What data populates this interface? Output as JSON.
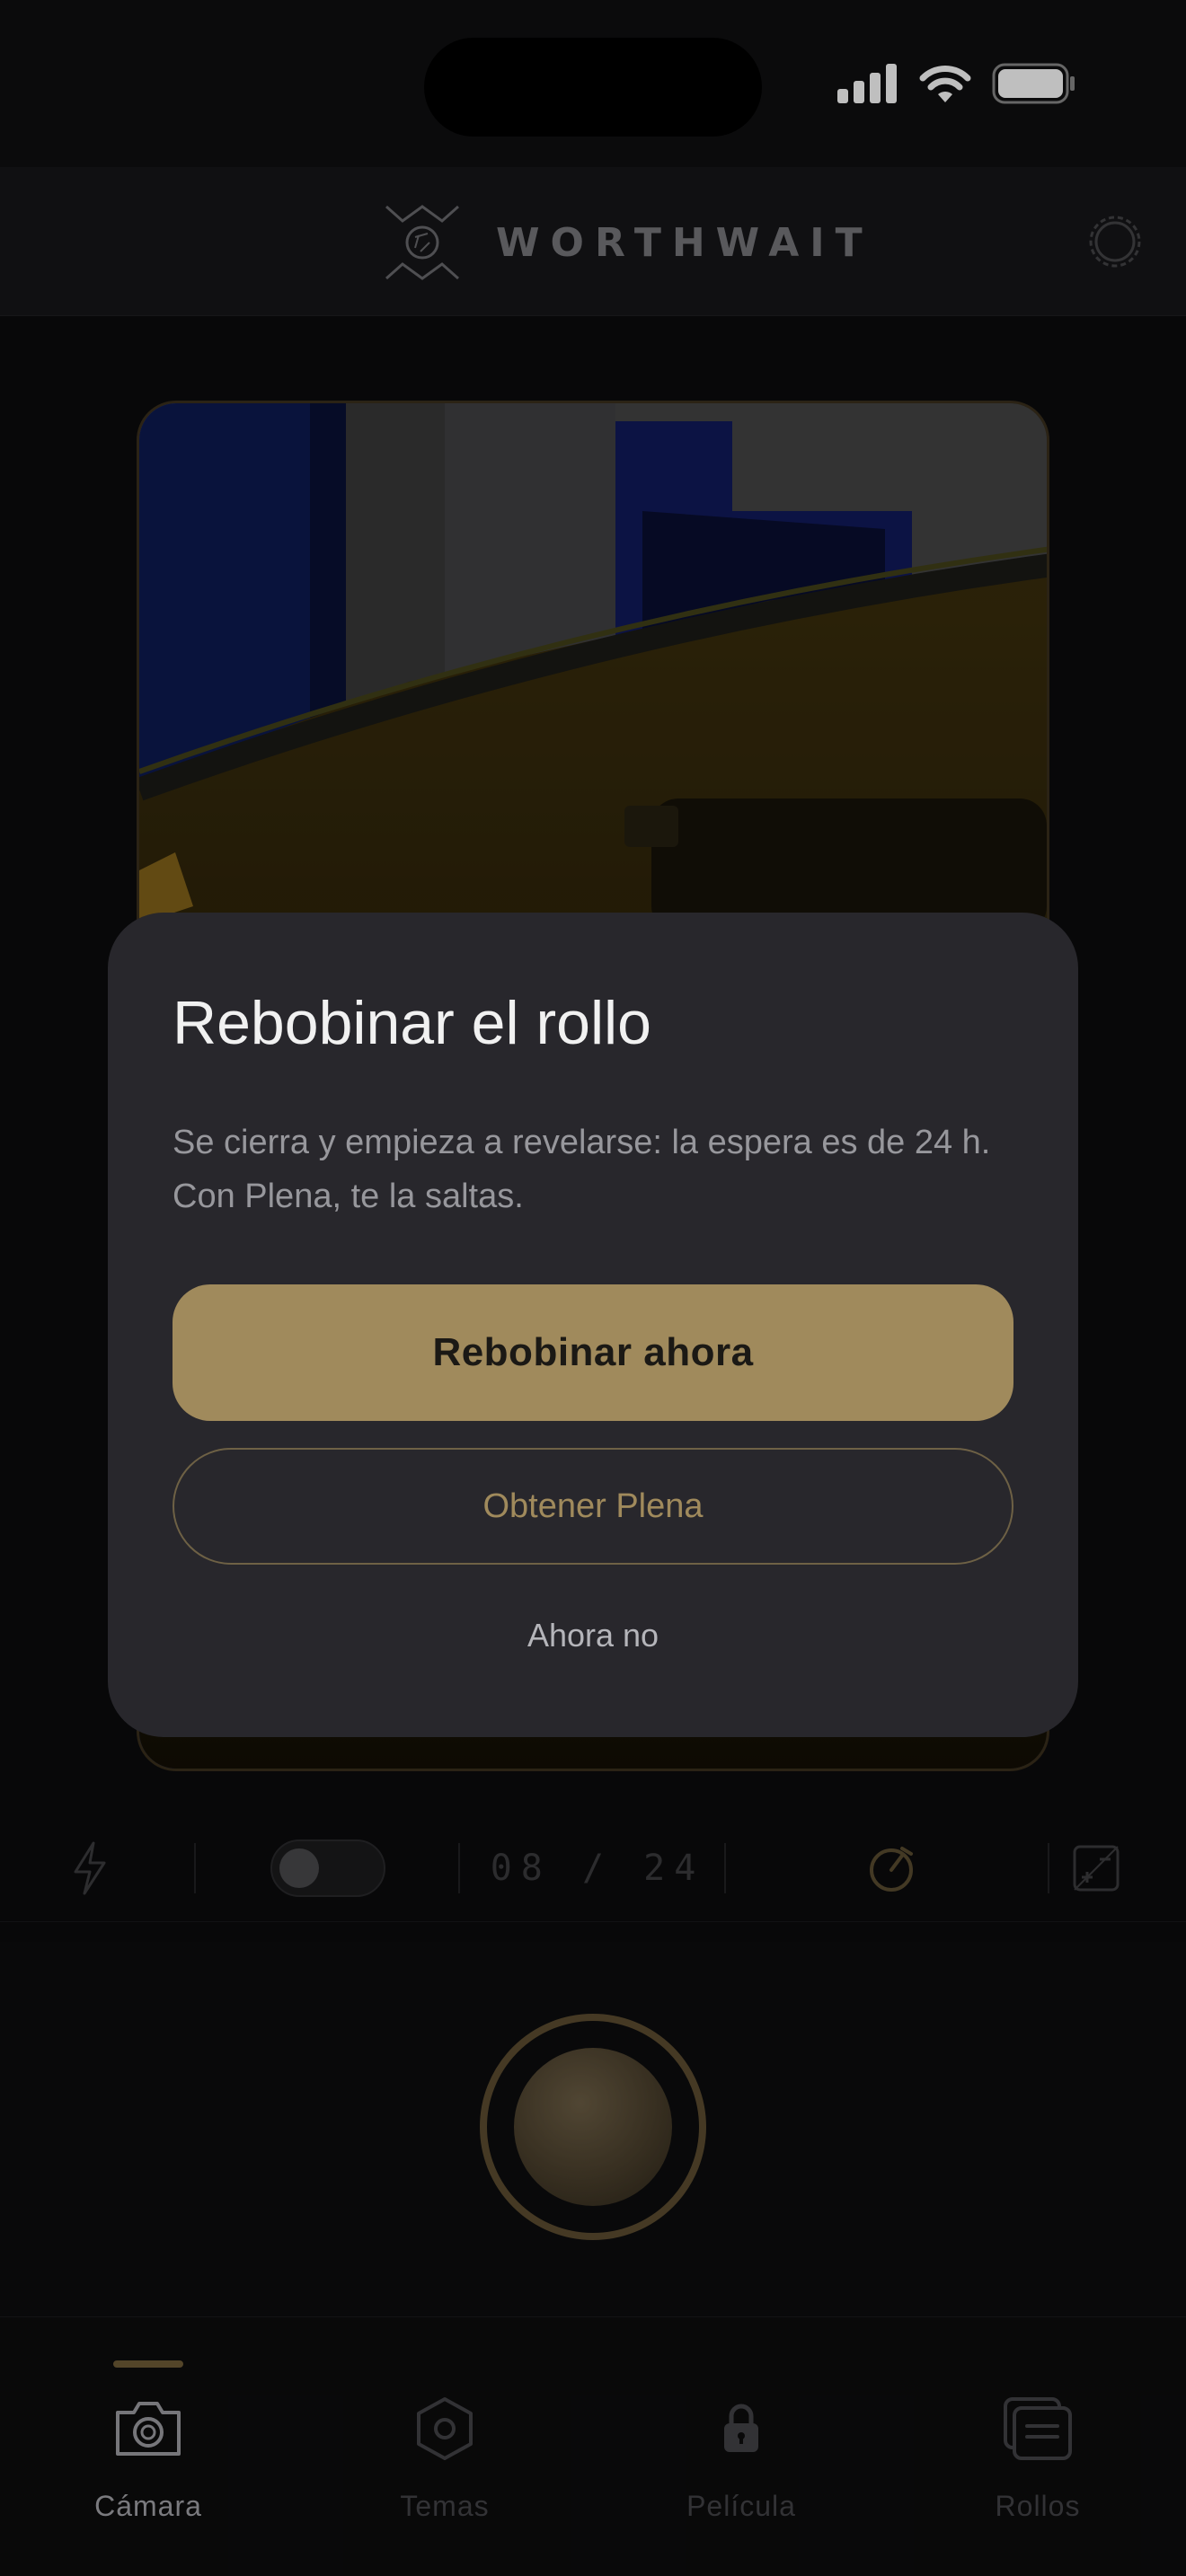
{
  "app": {
    "brand_name": "WORTHWAIT"
  },
  "status_bar": {
    "icons": [
      "signal-icon",
      "wifi-icon",
      "battery-icon"
    ]
  },
  "controls": {
    "shot_counter": "08 / 24",
    "toggle_state": "off",
    "icons": [
      "flash-icon",
      "timer-icon",
      "exposure-icon"
    ]
  },
  "dialog": {
    "title": "Rebobinar el rollo",
    "body": "Se cierra y empieza a revelarse: la espera es de 24 h. Con Plena, te la saltas.",
    "primary_button": "Rebobinar ahora",
    "secondary_button": "Obtener Plena",
    "dismiss_button": "Ahora no"
  },
  "tabs": [
    {
      "label": "Cámara",
      "icon": "camera-icon",
      "active": true
    },
    {
      "label": "Temas",
      "icon": "hexagon-icon",
      "active": false
    },
    {
      "label": "Película",
      "icon": "lock-icon",
      "active": false
    },
    {
      "label": "Rollos",
      "icon": "rolls-icon",
      "active": false
    }
  ],
  "colors": {
    "accent": "#a08a5c",
    "dialog_bg": "#28272c",
    "background": "#0b0b0c",
    "tab_active": "#a3a3a8",
    "tab_inactive": "#434347"
  }
}
